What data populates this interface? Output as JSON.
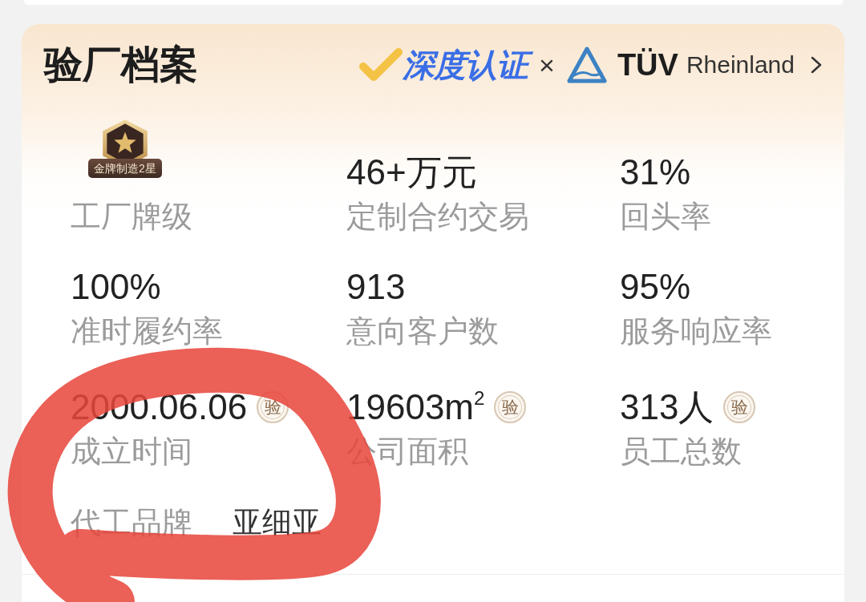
{
  "title": "验厂档案",
  "certification": {
    "brand": "深度认证",
    "separator": "×",
    "partner_mark": "TÜV",
    "partner_name": "Rheinland"
  },
  "stats": [
    {
      "kind": "medal",
      "medal_text": "金牌制造2星",
      "label": "工厂牌级"
    },
    {
      "kind": "value",
      "value": "46+万元",
      "label": "定制合约交易"
    },
    {
      "kind": "value",
      "value": "31%",
      "label": "回头率"
    },
    {
      "kind": "value",
      "value": "100%",
      "label": "准时履约率"
    },
    {
      "kind": "value",
      "value": "913",
      "label": "意向客户数"
    },
    {
      "kind": "value",
      "value": "95%",
      "label": "服务响应率"
    },
    {
      "kind": "value",
      "value": "2000.06.06",
      "label": "成立时间",
      "seal": "验"
    },
    {
      "kind": "value",
      "value": "19603m$^{2}$",
      "label": "公司面积",
      "seal": "验"
    },
    {
      "kind": "value",
      "value": "313人",
      "label": "员工总数",
      "seal": "验"
    }
  ],
  "oem_brand": {
    "label": "代工品牌",
    "value": "亚细亚"
  },
  "annotation": {
    "kind": "freehand_loop"
  }
}
